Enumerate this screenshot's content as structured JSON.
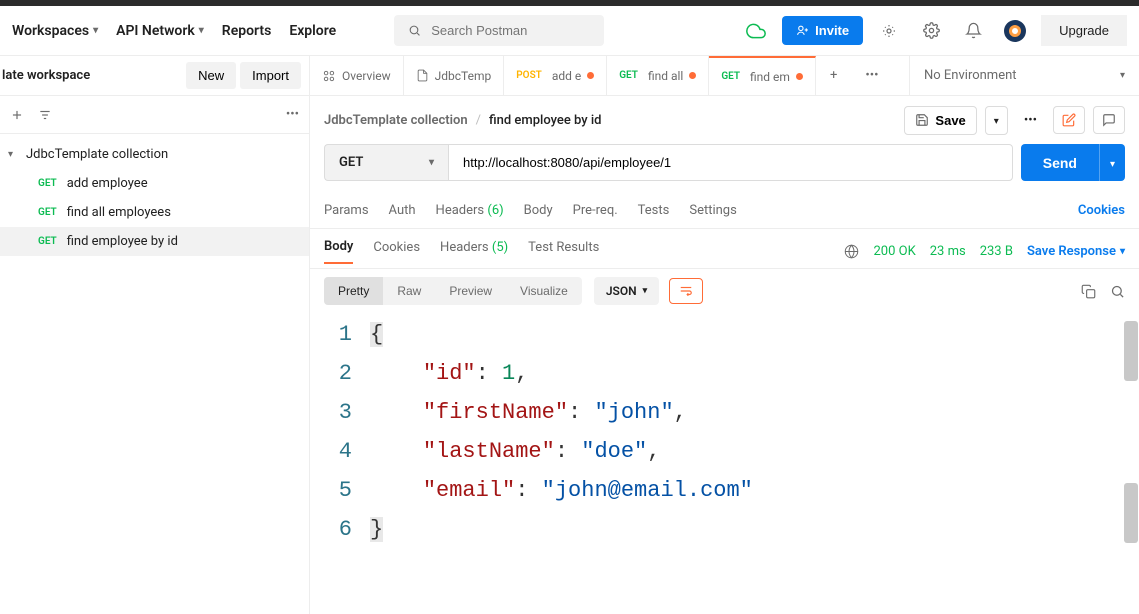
{
  "header": {
    "nav": [
      "Workspaces",
      "API Network",
      "Reports",
      "Explore"
    ],
    "search_placeholder": "Search Postman",
    "invite_label": "Invite",
    "upgrade_label": "Upgrade"
  },
  "sidebar": {
    "workspace_title": "late workspace",
    "new_btn": "New",
    "import_btn": "Import",
    "collection_name": "JdbcTemplate collection",
    "items": [
      {
        "method": "GET",
        "name": "add employee"
      },
      {
        "method": "GET",
        "name": "find all employees"
      },
      {
        "method": "GET",
        "name": "find employee by id"
      }
    ]
  },
  "tabs": [
    {
      "icon": "overview",
      "label": "Overview",
      "dot": false
    },
    {
      "icon": "file",
      "label": "JdbcTemp",
      "dot": false
    },
    {
      "method": "POST",
      "label": "add e",
      "dot": true
    },
    {
      "method": "GET",
      "label": "find all",
      "dot": true
    },
    {
      "method": "GET",
      "label": "find em",
      "dot": true
    }
  ],
  "environment": "No Environment",
  "breadcrumb": {
    "collection": "JdbcTemplate collection",
    "request": "find employee by id",
    "save_label": "Save"
  },
  "request": {
    "method": "GET",
    "url": "http://localhost:8080/api/employee/1",
    "send_label": "Send"
  },
  "req_tabs": {
    "params": "Params",
    "auth": "Auth",
    "headers": "Headers",
    "headers_count": "(6)",
    "body": "Body",
    "prereq": "Pre-req.",
    "tests": "Tests",
    "settings": "Settings",
    "cookies": "Cookies"
  },
  "response": {
    "tabs": {
      "body": "Body",
      "cookies": "Cookies",
      "headers": "Headers",
      "headers_count": "(5)",
      "test_results": "Test Results"
    },
    "status_code": "200 OK",
    "time": "23 ms",
    "size": "233 B",
    "save_response": "Save Response"
  },
  "pretty_bar": {
    "pretty": "Pretty",
    "raw": "Raw",
    "preview": "Preview",
    "visualize": "Visualize",
    "format": "JSON"
  },
  "response_body": {
    "line_numbers": [
      "1",
      "2",
      "3",
      "4",
      "5",
      "6"
    ],
    "json": {
      "id": 1,
      "firstName": "john",
      "lastName": "doe",
      "email": "john@email.com"
    }
  }
}
